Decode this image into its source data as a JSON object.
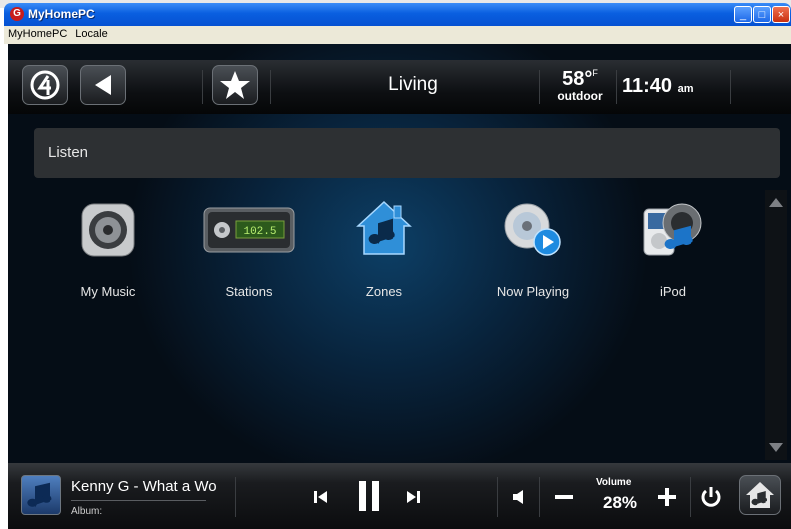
{
  "window": {
    "title": "MyHomePC"
  },
  "menu": {
    "items": [
      "MyHomePC",
      "Locale"
    ]
  },
  "topbar": {
    "room": "Living",
    "temperature": {
      "value": "58°",
      "unit": "F",
      "label": "outdoor"
    },
    "clock": {
      "time": "11:40",
      "ampm": "am"
    }
  },
  "section": {
    "title": "Listen"
  },
  "tiles": [
    {
      "label": "My Music",
      "icon": "speaker-icon"
    },
    {
      "label": "Stations",
      "icon": "radio-icon",
      "display": "102.5"
    },
    {
      "label": "Zones",
      "icon": "zones-icon"
    },
    {
      "label": "Now Playing",
      "icon": "now-playing-icon"
    },
    {
      "label": "iPod",
      "icon": "ipod-icon"
    }
  ],
  "now_playing": {
    "title": "Kenny G - What a Wo",
    "album_label": "Album:"
  },
  "volume": {
    "label": "Volume",
    "value": "28%"
  }
}
